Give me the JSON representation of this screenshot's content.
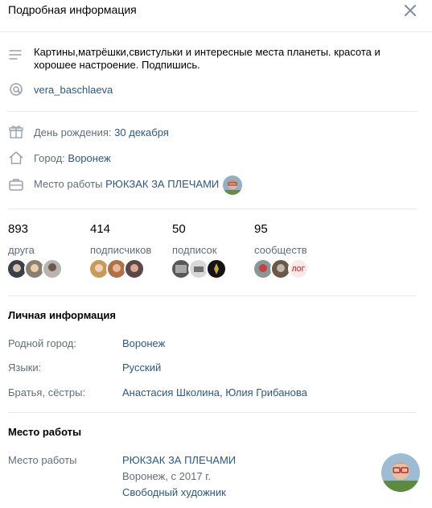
{
  "header": {
    "title": "Подробная информация"
  },
  "about": {
    "status": "Картины,матрёшки,свистульки и интересные места планеты. красота и хорошее настроение. Подпишись.",
    "nickname": "vera_baschlaeva"
  },
  "details": {
    "birthday_label": "День рождения:",
    "birthday_value": "30 декабря",
    "city_label": "Город:",
    "city_value": "Воронеж",
    "work_label": "Место работы",
    "work_value": "РЮКЗАК ЗА ПЛЕЧАМИ"
  },
  "counters": [
    {
      "num": "893",
      "label": "друга"
    },
    {
      "num": "414",
      "label": "подписчиков"
    },
    {
      "num": "50",
      "label": "подписок"
    },
    {
      "num": "95",
      "label": "сообществ"
    }
  ],
  "personal": {
    "title": "Личная информация",
    "hometown_label": "Родной город:",
    "hometown_value": "Воронеж",
    "languages_label": "Языки:",
    "languages_value": "Русский",
    "siblings_label": "Братья, сёстры:",
    "siblings_value": "Анастасия Школина, Юлия Грибанова"
  },
  "career": {
    "title": "Место работы",
    "label": "Место работы",
    "company": "РЮКЗАК ЗА ПЛЕЧАМИ",
    "location_period": "Воронеж, с 2017 г.",
    "position": "Свободный художник"
  },
  "group_badge_text": "ЛОГ",
  "colors": {
    "link": "#2a5885",
    "muted": "#626d7a",
    "divider": "#e7e8ec",
    "icon": "#99a2ad"
  }
}
